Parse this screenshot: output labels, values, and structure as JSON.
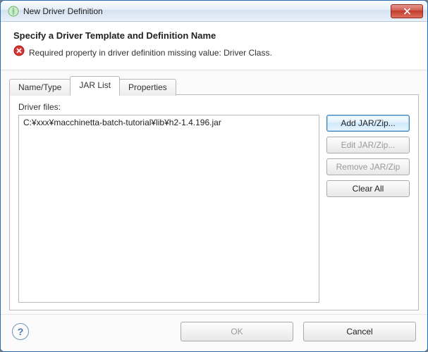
{
  "window": {
    "title": "New Driver Definition"
  },
  "header": {
    "heading": "Specify a Driver Template and Definition Name",
    "error": "Required property in driver definition missing value: Driver Class."
  },
  "tabs": {
    "name_type": "Name/Type",
    "jar_list": "JAR List",
    "properties": "Properties",
    "active": "jar_list"
  },
  "jar_panel": {
    "label": "Driver files:",
    "files": [
      "C:¥xxx¥macchinetta-batch-tutorial¥lib¥h2-1.4.196.jar"
    ]
  },
  "buttons": {
    "add": "Add JAR/Zip...",
    "edit": "Edit JAR/Zip...",
    "remove": "Remove JAR/Zip",
    "clear": "Clear All",
    "ok": "OK",
    "cancel": "Cancel"
  }
}
